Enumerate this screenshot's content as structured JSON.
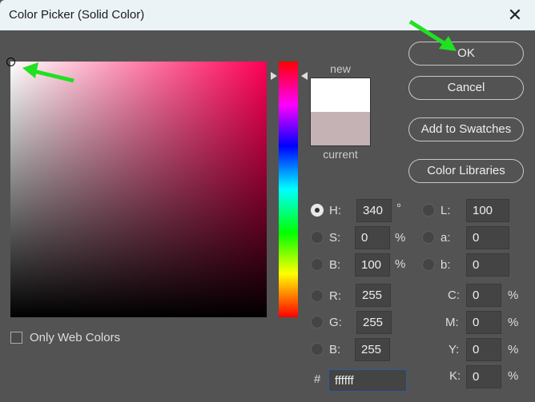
{
  "window": {
    "title": "Color Picker (Solid Color)",
    "close_glyph": "✕"
  },
  "picker": {
    "hue_deg": 340,
    "selected_color": "#ffffff",
    "hue_color": "#ff0055"
  },
  "preview": {
    "new_label": "new",
    "current_label": "current",
    "new_color": "#ffffff",
    "current_color": "#c4b2b5"
  },
  "buttons": {
    "ok": "OK",
    "cancel": "Cancel",
    "add_to_swatches": "Add to Swatches",
    "color_libraries": "Color Libraries"
  },
  "fields": {
    "H": {
      "label": "H:",
      "value": "340",
      "unit": "°"
    },
    "S": {
      "label": "S:",
      "value": "0",
      "unit": "%"
    },
    "Bv": {
      "label": "B:",
      "value": "100",
      "unit": "%"
    },
    "L": {
      "label": "L:",
      "value": "100"
    },
    "a": {
      "label": "a:",
      "value": "0"
    },
    "b": {
      "label": "b:",
      "value": "0"
    },
    "R": {
      "label": "R:",
      "value": "255"
    },
    "G": {
      "label": "G:",
      "value": "255"
    },
    "Bl": {
      "label": "B:",
      "value": "255"
    },
    "C": {
      "label": "C:",
      "value": "0",
      "unit": "%"
    },
    "M": {
      "label": "M:",
      "value": "0",
      "unit": "%"
    },
    "Y": {
      "label": "Y:",
      "value": "0",
      "unit": "%"
    },
    "K": {
      "label": "K:",
      "value": "0",
      "unit": "%"
    },
    "hex": {
      "label": "#",
      "value": "ffffff"
    }
  },
  "only_web_colors": {
    "label": "Only Web Colors",
    "checked": false
  }
}
